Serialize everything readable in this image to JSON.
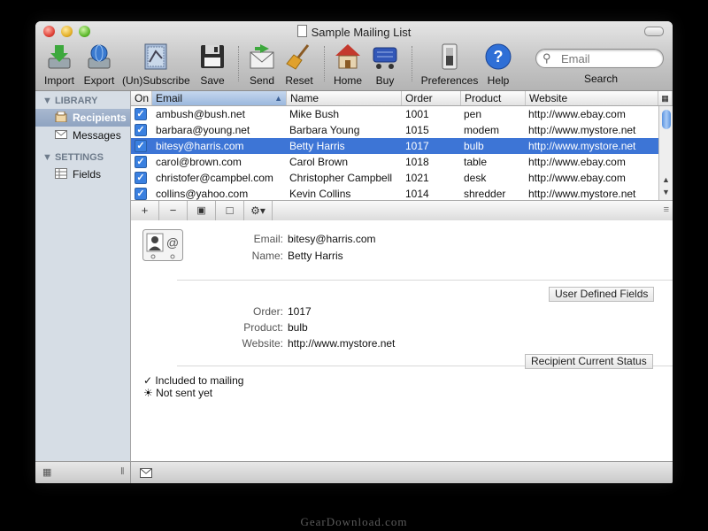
{
  "window": {
    "title": "Sample Mailing List"
  },
  "toolbar": {
    "items": [
      {
        "label": "Import",
        "icon": "import-icon"
      },
      {
        "label": "Export",
        "icon": "export-icon"
      },
      {
        "label": "(Un)Subscribe",
        "icon": "unsubscribe-icon"
      },
      {
        "label": "Save",
        "icon": "save-icon"
      },
      {
        "label": "Send",
        "icon": "send-icon"
      },
      {
        "label": "Reset",
        "icon": "broom-icon"
      },
      {
        "label": "Home",
        "icon": "home-icon"
      },
      {
        "label": "Buy",
        "icon": "cart-icon"
      },
      {
        "label": "Preferences",
        "icon": "switch-icon"
      },
      {
        "label": "Help",
        "icon": "help-icon"
      }
    ],
    "search": {
      "placeholder": "Email",
      "label": "Search"
    }
  },
  "sidebar": {
    "library_header": "LIBRARY",
    "settings_header": "SETTINGS",
    "items": [
      {
        "label": "Recipients",
        "selected": true
      },
      {
        "label": "Messages"
      },
      {
        "label": "Fields"
      }
    ]
  },
  "table": {
    "columns": [
      "On",
      "Email",
      "Name",
      "Order",
      "Product",
      "Website"
    ],
    "rows": [
      {
        "email": "ambush@bush.net",
        "name": "Mike Bush",
        "order": "1001",
        "product": "pen",
        "website": "http://www.ebay.com"
      },
      {
        "email": "barbara@young.net",
        "name": "Barbara Young",
        "order": "1015",
        "product": "modem",
        "website": "http://www.mystore.net"
      },
      {
        "email": "bitesy@harris.com",
        "name": "Betty Harris",
        "order": "1017",
        "product": "bulb",
        "website": "http://www.mystore.net"
      },
      {
        "email": "carol@brown.com",
        "name": "Carol Brown",
        "order": "1018",
        "product": "table",
        "website": "http://www.ebay.com"
      },
      {
        "email": "christofer@campbel.com",
        "name": "Christopher Campbell",
        "order": "1021",
        "product": "desk",
        "website": "http://www.ebay.com"
      },
      {
        "email": "collins@yahoo.com",
        "name": "Kevin Collins",
        "order": "1014",
        "product": "shredder",
        "website": "http://www.mystore.net"
      }
    ],
    "selected_row": 2
  },
  "buttons": {
    "add": "+",
    "remove": "−",
    "b3": "▣",
    "b4": "□",
    "gear": "⚙▾"
  },
  "detail": {
    "email_label": "Email:",
    "email": "bitesy@harris.com",
    "name_label": "Name:",
    "name": "Betty Harris",
    "user_fields_button": "User Defined Fields",
    "order_label": "Order:",
    "order": "1017",
    "product_label": "Product:",
    "product": "bulb",
    "website_label": "Website:",
    "website": "http://www.mystore.net",
    "status_button": "Recipient Current Status",
    "status1": "✓ Included to mailing",
    "status2": "☀ Not sent yet"
  },
  "watermark": "GearDownload.com"
}
